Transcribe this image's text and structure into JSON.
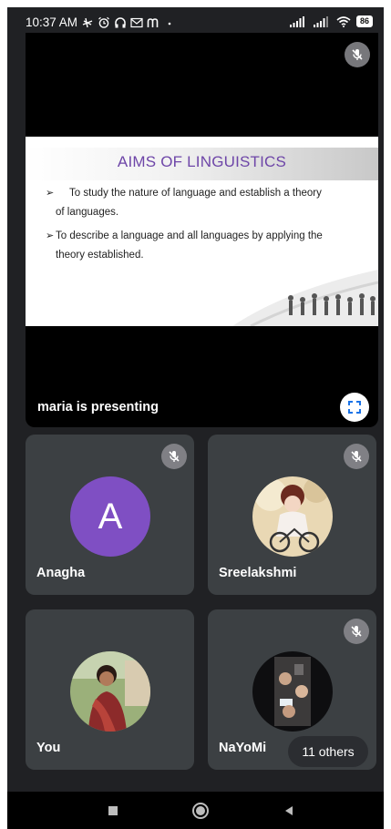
{
  "status": {
    "time": "10:37 AM",
    "battery": "86"
  },
  "presentation": {
    "slide_title": "AIMS OF LINGUISTICS",
    "bullets": [
      {
        "line1": "To study the nature of language and establish a theory",
        "line2": "of languages."
      },
      {
        "line1": "To describe a language and all languages by applying the",
        "line2": "theory established."
      }
    ],
    "presenter_text": "maria is presenting"
  },
  "participants": [
    {
      "name": "Anagha",
      "avatar": "A",
      "muted": true
    },
    {
      "name": "Sreelakshmi",
      "muted": true
    },
    {
      "name": "You",
      "muted": false
    },
    {
      "name": "NaYoMi",
      "muted": true
    }
  ],
  "others_label": "11 others",
  "colors": {
    "background": "#202124",
    "tile": "#3c4043",
    "avatar_purple": "#7f4fc3",
    "slide_title": "#6e46a8"
  },
  "icons": [
    "mic-off-icon",
    "fullscreen-icon",
    "recents-icon",
    "home-icon",
    "back-icon"
  ]
}
